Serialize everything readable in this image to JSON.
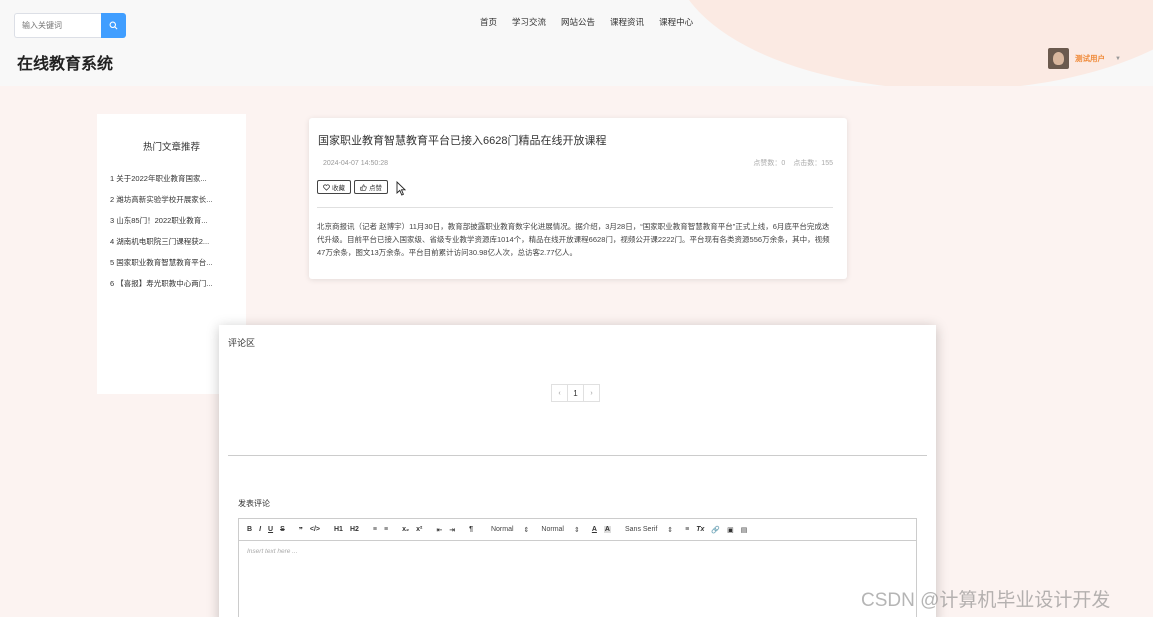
{
  "header": {
    "search_placeholder": "输入关键词",
    "site_title": "在线教育系统",
    "nav": [
      "首页",
      "学习交流",
      "网站公告",
      "课程资讯",
      "课程中心"
    ],
    "user_name": "测试用户"
  },
  "sidebar": {
    "title": "热门文章推荐",
    "items": [
      "1  关于2022年职业教育国家...",
      "2  潍坊高新实验学校开展家长...",
      "3  山东85门！2022职业教育...",
      "4  湖南机电职院三门课程获2...",
      "5  国家职业教育智慧教育平台...",
      "6  【喜报】寿光职教中心两门..."
    ]
  },
  "article": {
    "title": "国家职业教育智慧教育平台已接入6628门精品在线开放课程",
    "date": "2024-04-07 14:50:28",
    "likes": "点赞数：0",
    "clicks": "点击数：155",
    "favorite_label": "收藏",
    "like_label": "点赞",
    "body": "北京商报讯（记者 赵博宇）11月30日，教育部披露职业教育数字化进展情况。据介绍，3月28日，“国家职业教育智慧教育平台”正式上线，6月底平台完成迭代升级。目前平台已接入国家级、省级专业教学资源库1014个，精品在线开放课程6628门，视频公开课2222门。平台现有各类资源556万余条，其中，视频47万余条，图文13万余条。平台目前累计访问30.98亿人次，总访客2.77亿人。"
  },
  "comments": {
    "title": "评论区",
    "pager": {
      "prev": "‹",
      "current": "1",
      "next": "›"
    },
    "post_title": "发表评论",
    "toolbar": {
      "bold": "B",
      "italic": "I",
      "underline": "U",
      "strike": "S",
      "blockquote": "❞",
      "code": "</>",
      "h1": "H1",
      "h2": "H2",
      "ordered": "≡",
      "bullet": "≡",
      "sub": "x₂",
      "sup": "x²",
      "outdent": "⇤",
      "indent": "⇥",
      "rtl": "¶",
      "size1": "Normal",
      "size2": "Normal",
      "font": "Sans Serif",
      "color": "A",
      "bg": "A",
      "align": "≡",
      "clean": "Tx"
    },
    "editor_placeholder": "Insert text here ..."
  },
  "watermark": "CSDN @计算机毕业设计开发",
  "colors": {
    "accent": "#409eff",
    "user_name": "#f08c3c",
    "page_bg": "#fcf3f1"
  }
}
